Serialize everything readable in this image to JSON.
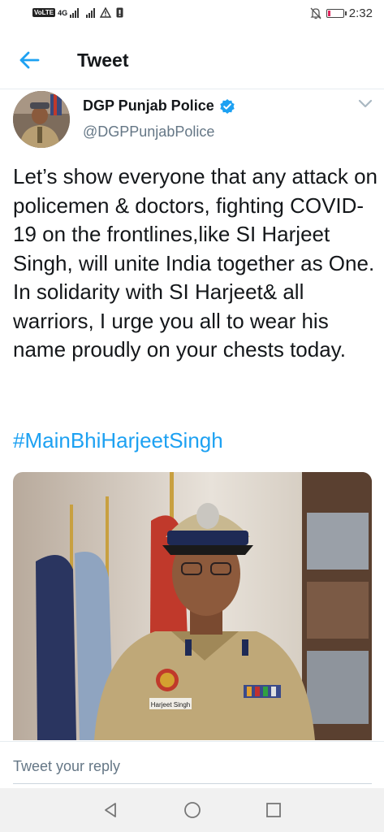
{
  "status_bar": {
    "volte": "VoLTE",
    "network": "4G",
    "time": "2:32",
    "icons": [
      "signal-icon",
      "wifi-icon",
      "alert-icon",
      "sim-icon",
      "mute-icon",
      "battery-icon"
    ]
  },
  "header": {
    "back_icon": "arrow-left-icon",
    "title": "Tweet"
  },
  "tweet": {
    "author_name": "DGP Punjab Police",
    "verified": true,
    "handle": "@DGPPunjabPolice",
    "text": "Let’s show everyone that any attack on policemen & doctors, fighting COVID-19 on the frontlines,like SI Harjeet Singh, will unite India together as One.\nIn solidarity with SI Harjeet& all warriors, I urge you all to wear his name proudly on your chests today.",
    "hashtag": "#MainBhiHarjeetSingh",
    "media": {
      "name_tag": "Harjeet Singh"
    }
  },
  "reply": {
    "placeholder": "Tweet your reply"
  },
  "colors": {
    "accent": "#1da1f2",
    "text": "#14171a",
    "secondary": "#657786"
  }
}
